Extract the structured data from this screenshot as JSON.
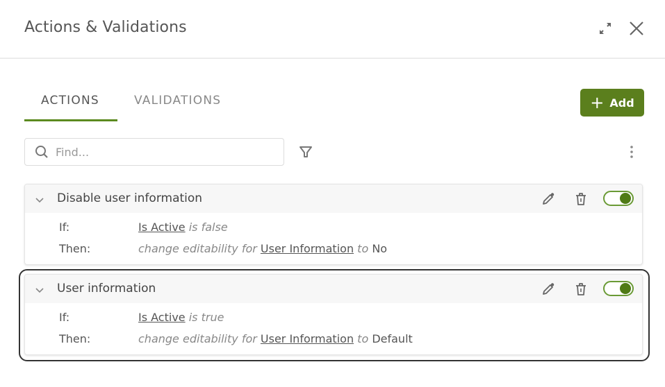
{
  "dialog": {
    "title": "Actions & Validations",
    "expand_icon": "expand-icon",
    "close_icon": "close-icon"
  },
  "tabs": [
    {
      "label": "ACTIONS",
      "active": true
    },
    {
      "label": "VALIDATIONS",
      "active": false
    }
  ],
  "toolbar": {
    "add_label": "Add",
    "add_icon": "plus-icon",
    "search_placeholder": "Find...",
    "search_value": "",
    "filter_icon": "filter-icon",
    "more_icon": "more-vertical-icon"
  },
  "colors": {
    "accent": "#5b7f1d",
    "toggle_on": "#4f7a15",
    "tab_underline": "#5b8a1f"
  },
  "actions": [
    {
      "title": "Disable user information",
      "enabled": true,
      "if_label": "If:",
      "if_field": "Is Active",
      "if_condition": "is false",
      "then_label": "Then:",
      "then_prefix": "change editability for",
      "then_target": "User Information",
      "then_to": "to",
      "then_value": "No"
    },
    {
      "title": "User information",
      "enabled": true,
      "focused": true,
      "if_label": "If:",
      "if_field": "Is Active",
      "if_condition": "is true",
      "then_label": "Then:",
      "then_prefix": "change editability for",
      "then_target": "User Information",
      "then_to": "to",
      "then_value": "Default"
    }
  ]
}
